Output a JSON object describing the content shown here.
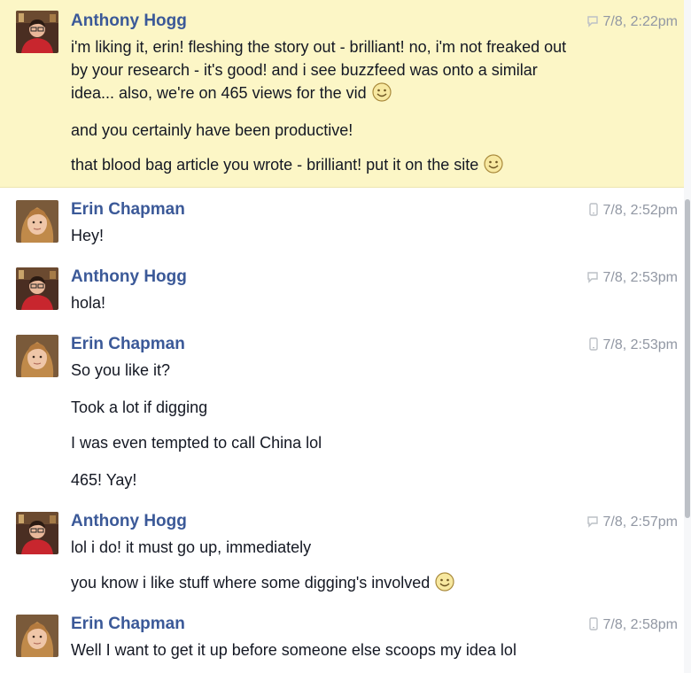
{
  "messages": [
    {
      "author": "Anthony Hogg",
      "time": "7/8, 2:22pm",
      "device": "web",
      "highlight": true,
      "lines": [
        "i'm liking it, erin! fleshing the story out - brilliant! no, i'm not freaked out",
        "by your research - it's good! and i see buzzfeed was onto a similar",
        "idea... also, we're on 465 views for the vid",
        "and you certainly have been productive!",
        "that blood bag article you wrote - brilliant! put it on the site"
      ]
    },
    {
      "author": "Erin Chapman",
      "time": "7/8, 2:52pm",
      "device": "mobile",
      "lines": [
        "Hey!"
      ]
    },
    {
      "author": "Anthony Hogg",
      "time": "7/8, 2:53pm",
      "device": "web",
      "lines": [
        "hola!"
      ]
    },
    {
      "author": "Erin Chapman",
      "time": "7/8, 2:53pm",
      "device": "mobile",
      "lines": [
        "So you like it?",
        "Took a lot if digging",
        "I was even tempted to call China lol",
        "465! Yay!"
      ]
    },
    {
      "author": "Anthony Hogg",
      "time": "7/8, 2:57pm",
      "device": "web",
      "lines": [
        "lol i do! it must go up, immediately",
        "you know i like stuff where some digging's involved"
      ]
    },
    {
      "author": "Erin Chapman",
      "time": "7/8, 2:58pm",
      "device": "mobile",
      "lines": [
        "Well I want to get it up before someone else scoops my idea lol"
      ]
    }
  ],
  "colors": {
    "author_name": "#3b5998",
    "highlight_bg": "#fcf6c6",
    "timestamp": "#9197a3"
  },
  "icons": {
    "web_device": "chat-bubble-icon",
    "mobile_device": "phone-icon",
    "emoticon": "smiley-icon"
  }
}
